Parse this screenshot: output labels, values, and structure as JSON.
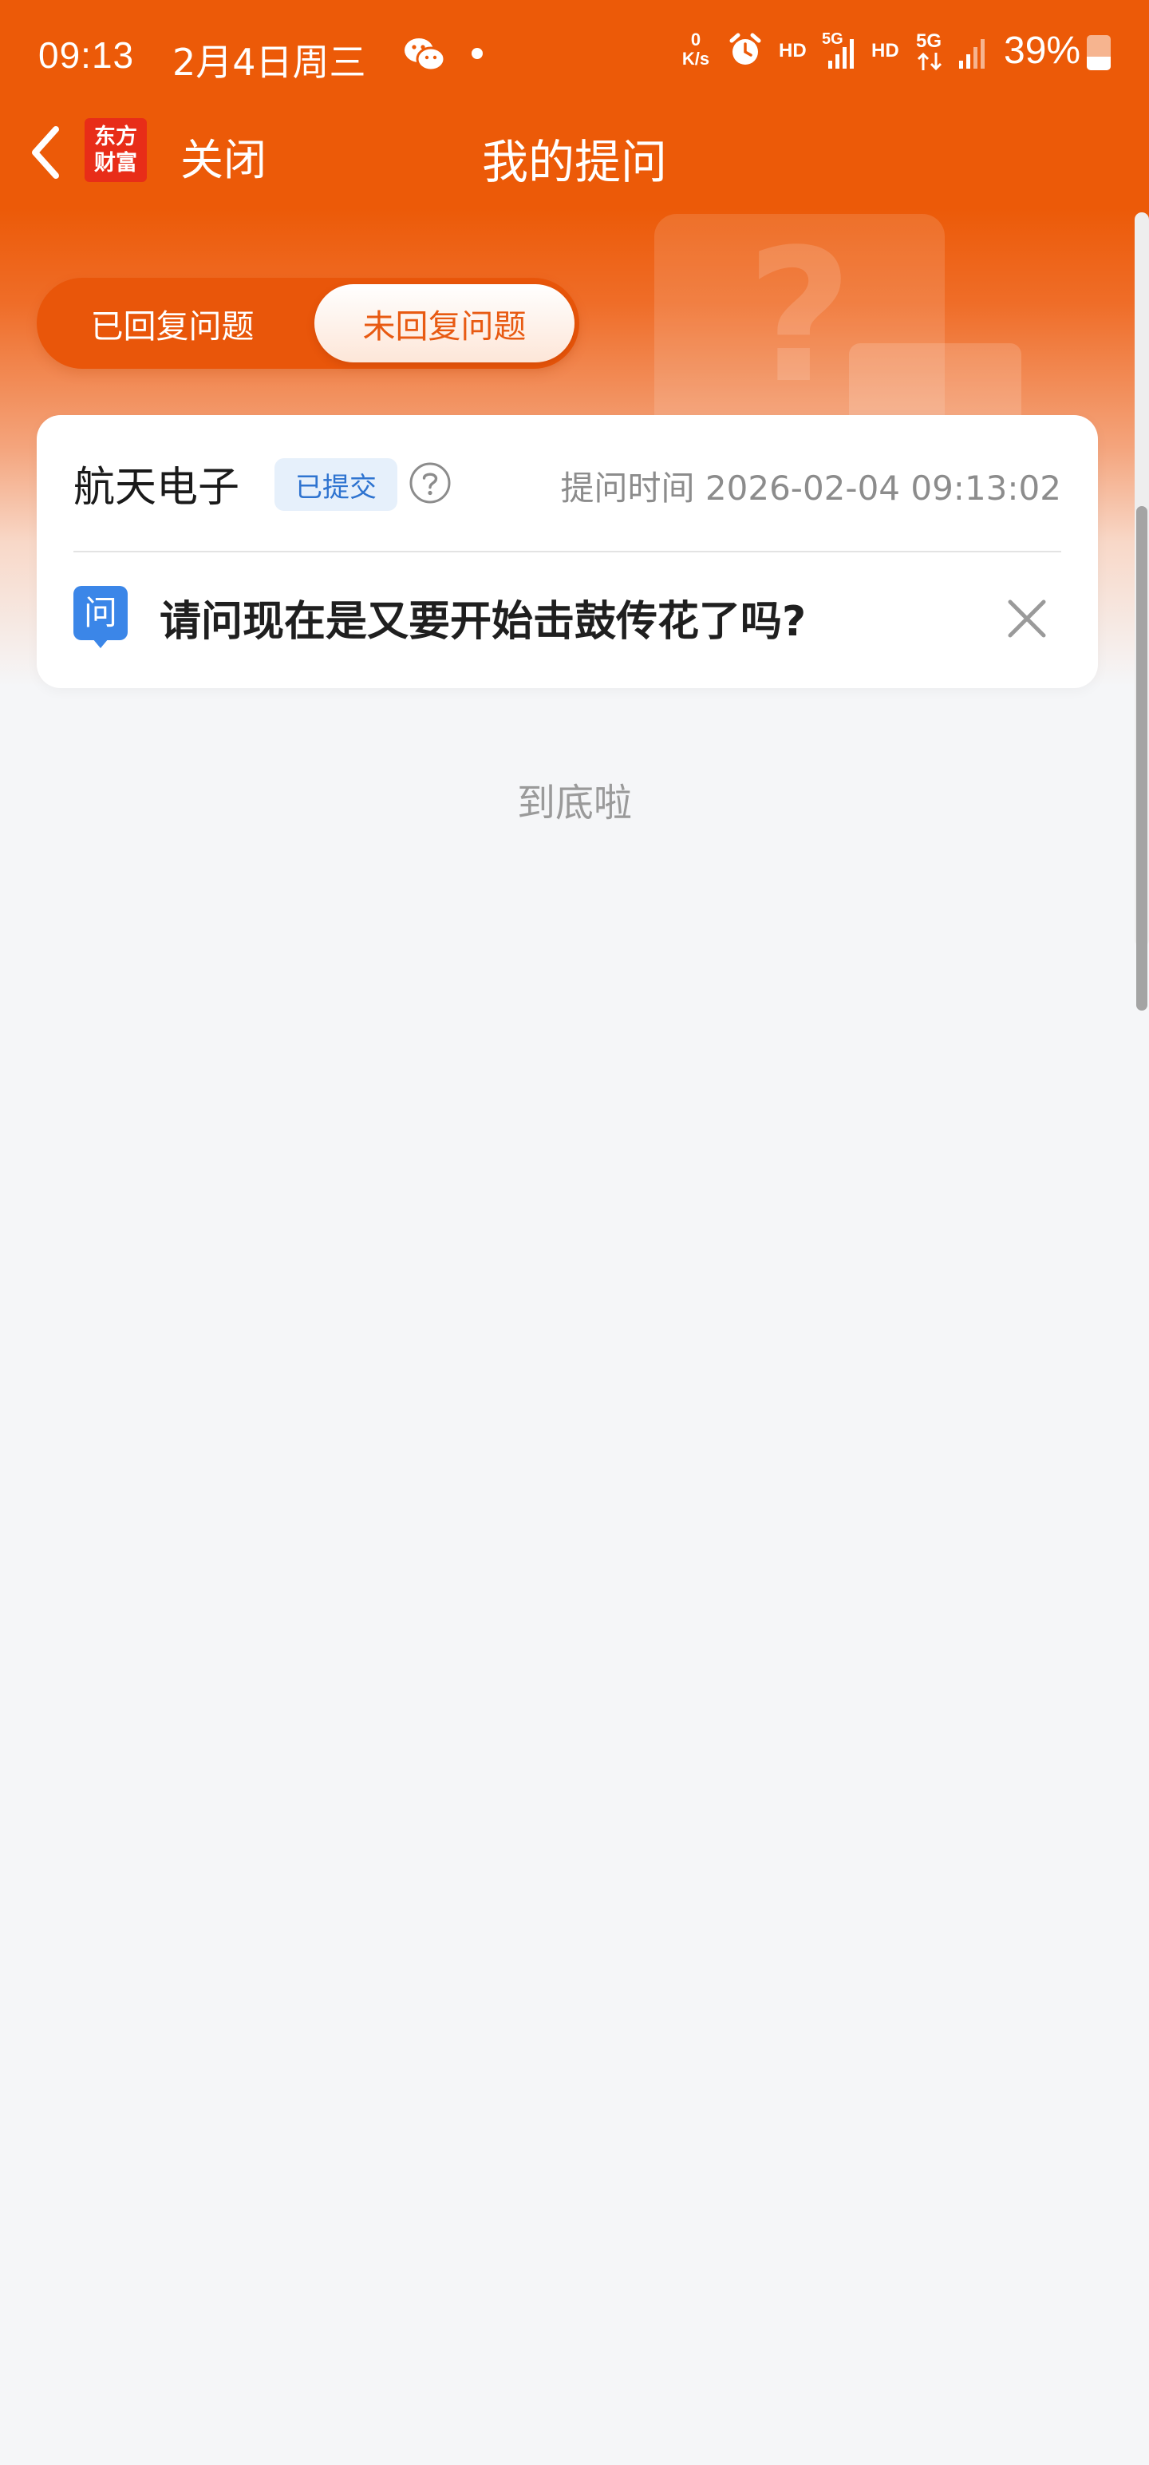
{
  "status_bar": {
    "time": "09:13",
    "date": "2月4日周三",
    "net_speed_value": "0",
    "net_speed_unit": "K/s",
    "hd_1": "HD",
    "sig_1": "5G",
    "hd_2": "HD",
    "sig_2": "5G",
    "battery": "39%",
    "battery_level": 0.39,
    "icons": [
      "wechat-icon",
      "alarm-icon",
      "signal-icon",
      "battery-icon"
    ]
  },
  "nav": {
    "logo_line1": "东方",
    "logo_line2": "财富",
    "close_label": "关闭",
    "title": "我的提问"
  },
  "tabs": [
    {
      "label": "已回复问题",
      "active": false
    },
    {
      "label": "未回复问题",
      "active": true
    }
  ],
  "question_card": {
    "stock_name": "航天电子",
    "status_badge": "已提交",
    "time_label": "提问时间",
    "time_value": "2026-02-04 09:13:02",
    "question_icon_char": "问",
    "question_text": "请问现在是又要开始击鼓传花了吗?"
  },
  "footer": {
    "end_text": "到底啦"
  },
  "colors": {
    "brand_orange": "#ec5a08",
    "badge_blue": "#2f74d0",
    "badge_bg": "#e6f0fb",
    "page_bg": "#f5f6f8"
  }
}
